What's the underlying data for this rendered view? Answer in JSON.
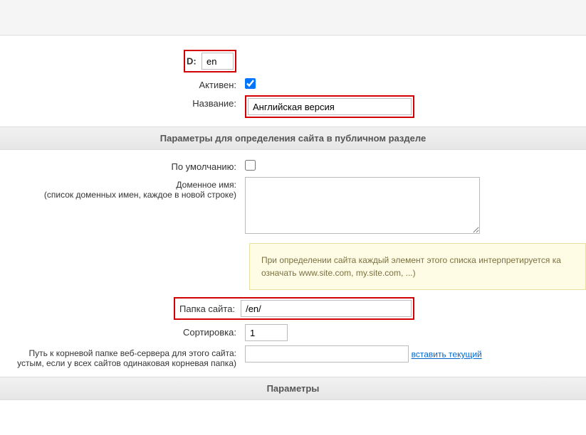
{
  "fields": {
    "id_label": "D:",
    "id_value": "en",
    "active_label": "Активен:",
    "active_checked": true,
    "name_label": "Название:",
    "name_value": "Английская версия",
    "default_label": "По умолчанию:",
    "default_checked": false,
    "domain_label": "Доменное имя:",
    "domain_sublabel": "(список доменных имен, каждое в новой строке)",
    "domain_value": "",
    "folder_label": "Папка сайта:",
    "folder_value": "/en/",
    "sort_label": "Сортировка:",
    "sort_value": "1",
    "docroot_label": "Путь к корневой папке веб-сервера для этого сайта:",
    "docroot_sublabel": "устым, если у всех сайтов одинаковая корневая папка)",
    "docroot_value": "",
    "docroot_link": "вставить текущий"
  },
  "sections": {
    "public": "Параметры для определения сайта в публичном разделе",
    "params": "Параметры"
  },
  "hint": {
    "text": "При определении сайта каждый элемент этого списка интерпретируется ка означать www.site.com, my.site.com, ...)"
  }
}
